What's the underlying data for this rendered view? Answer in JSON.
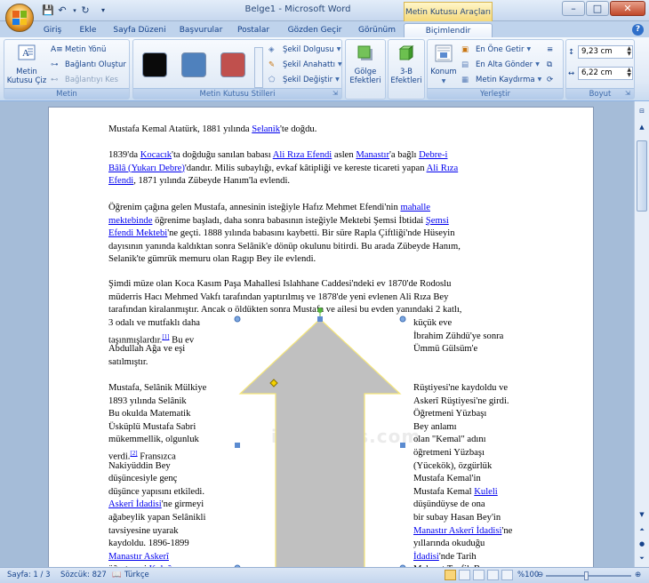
{
  "window": {
    "title": "Belge1 - Microsoft Word",
    "context_tab_header": "Metin Kutusu Araçları",
    "minimize": "–",
    "maximize": "□",
    "close": "✕"
  },
  "tabs": [
    "Giriş",
    "Ekle",
    "Sayfa Düzeni",
    "Başvurular",
    "Postalar",
    "Gözden Geçir",
    "Görünüm",
    "Biçimlendir"
  ],
  "active_tab": "Biçimlendir",
  "ribbon": {
    "metin": {
      "label": "Metin",
      "metin_kutusu_ciz": "Metin Kutusu Çiz",
      "metin_yonu": "Metin Yönü",
      "baglanti_olustur": "Bağlantı Oluştur",
      "baglantiyi_kes": "Bağlantıyı Kes"
    },
    "stiller": {
      "label": "Metin Kutusu Stilleri",
      "swatches": [
        "#0a0a0a",
        "#4f81bd",
        "#c0504d"
      ],
      "sekil_dolgusu": "Şekil Dolgusu",
      "sekil_anahatti": "Şekil Anahattı",
      "sekil_degistir": "Şekil Değiştir"
    },
    "golge": {
      "label": "Gölge Efektleri"
    },
    "uc_b": {
      "label": "3-B Efektleri"
    },
    "yerlestir": {
      "label": "Yerleştir",
      "konum": "Konum",
      "en_one_getir": "En Öne Getir",
      "en_alta_gonder": "En Alta Gönder",
      "metin_kaydirma": "Metin Kaydırma"
    },
    "boyut": {
      "label": "Boyut",
      "height": "9,23 cm",
      "width": "6,22 cm"
    }
  },
  "document": {
    "p1": [
      "Mustafa Kemal Atatürk, 1881 yılında ",
      "Selanik",
      "'te doğdu."
    ],
    "p2_line1": [
      "1839'da ",
      "Kocacık",
      "'ta doğduğu sanılan babası ",
      "Ali Rıza Efendi",
      " aslen ",
      "Manastır",
      "'a bağlı ",
      "Debre-i"
    ],
    "p2_line2": [
      "Bâlâ (Yukarı Debre)",
      "'dandır. Milis subaylığı, evkaf kâtipliği ve kereste ticareti yapan ",
      "Ali Rıza"
    ],
    "p2_line3": [
      "Efendi",
      ", 1871 yılında Zübeyde Hanım'la evlendi."
    ],
    "p3_line1": [
      "Öğrenim çağına gelen Mustafa, annesinin isteğiyle Hafız Mehmet Efendi'nin ",
      "mahalle"
    ],
    "p3_line2": [
      "mektebinde",
      " öğrenime başladı, daha sonra babasının isteğiyle Mektebi Şemsi İbtidai ",
      "Şemsi"
    ],
    "p3_line3": [
      "Efendi Mektebi",
      "'ne geçti. 1888 yılında babasını kaybetti. Bir süre Rapla Çiftliği'nde Hüseyin"
    ],
    "p3_line4": "dayısının yanında kaldıktan sonra Selânik'e dönüp okulunu bitirdi. Bu arada Zübeyde Hanım,",
    "p3_line5": "Selanik'te gümrük memuru olan Ragıp Bey ile evlendi.",
    "p4_line1": "Şimdi müze olan Koca Kasım Paşa Mahallesi Islahhane Caddesi'ndeki ev 1870'de Rodoslu",
    "p4_line2": "müderris Hacı Mehmed Vakfı tarafından yaptırılmış ve 1878'de yeni evlenen Ali Rıza Bey",
    "p4_line3": "tarafından kiralanmıştır. Ancak o öldükten sonra Mustafa ve ailesi bu evden yanındaki 2 katlı,",
    "left_col": [
      [
        "3 odalı ve mutfaklı daha"
      ],
      [
        "taşınmışlardır.",
        "[1]",
        " Bu ev"
      ],
      [
        "Abdullah Ağa ve eşi"
      ],
      [
        "satılmıştır."
      ],
      [
        ""
      ],
      [
        "Mustafa, Selânik Mülkiye"
      ],
      [
        "1893 yılında Selânik"
      ],
      [
        "Bu okulda Matematik"
      ],
      [
        "Üsküplü Mustafa Sabri"
      ],
      [
        "mükemmellik, olgunluk"
      ],
      [
        "verdi.",
        "[2]",
        " Fransızca"
      ],
      [
        "Nakiyüddin Bey"
      ],
      [
        "düşüncesiyle genç"
      ],
      [
        "düşünce yapısını etkiledi."
      ],
      [
        "Askerî İdadisi",
        "'ne girmeyi"
      ],
      [
        "ağabeylik yapan Selânikli"
      ],
      [
        "tavsiyesine uyarak"
      ],
      [
        "kaydoldu. 1896-1899"
      ],
      [
        "Manastır Askerî"
      ],
      [
        "öğretmeni ",
        "Kolağası"
      ]
    ],
    "right_col": [
      [
        "küçük eve"
      ],
      [
        "İbrahim Zühdü'ye sonra"
      ],
      [
        "Ümmü Gülsüm'e"
      ],
      [
        ""
      ],
      [
        ""
      ],
      [
        "Rüştiyesi'ne kaydoldu ve"
      ],
      [
        "Askerî Rüştiyesi'ne girdi."
      ],
      [
        "Öğretmeni Yüzbaşı"
      ],
      [
        "Bey anlamı"
      ],
      [
        "olan \"Kemal\" adını"
      ],
      [
        "öğretmeni Yüzbaşı"
      ],
      [
        "(Yücekök), özgürlük"
      ],
      [
        "Mustafa Kemal'in"
      ],
      [
        "Mustafa Kemal ",
        "Kuleli"
      ],
      [
        "düşündüyse de ona"
      ],
      [
        "bir subay Hasan Bey'in"
      ],
      [
        "Manastır Askerî İdadisi",
        "'ne"
      ],
      [
        "yıllarında okuduğu"
      ],
      [
        "İdadisi",
        "'nde Tarih"
      ],
      [
        "Mehmet Tevfik Bey"
      ]
    ],
    "watermark": "itilaiders.com"
  },
  "status": {
    "page": "Sayfa: 1 / 3",
    "words": "Sözcük: 827",
    "language": "Türkçe",
    "zoom": "%100"
  }
}
